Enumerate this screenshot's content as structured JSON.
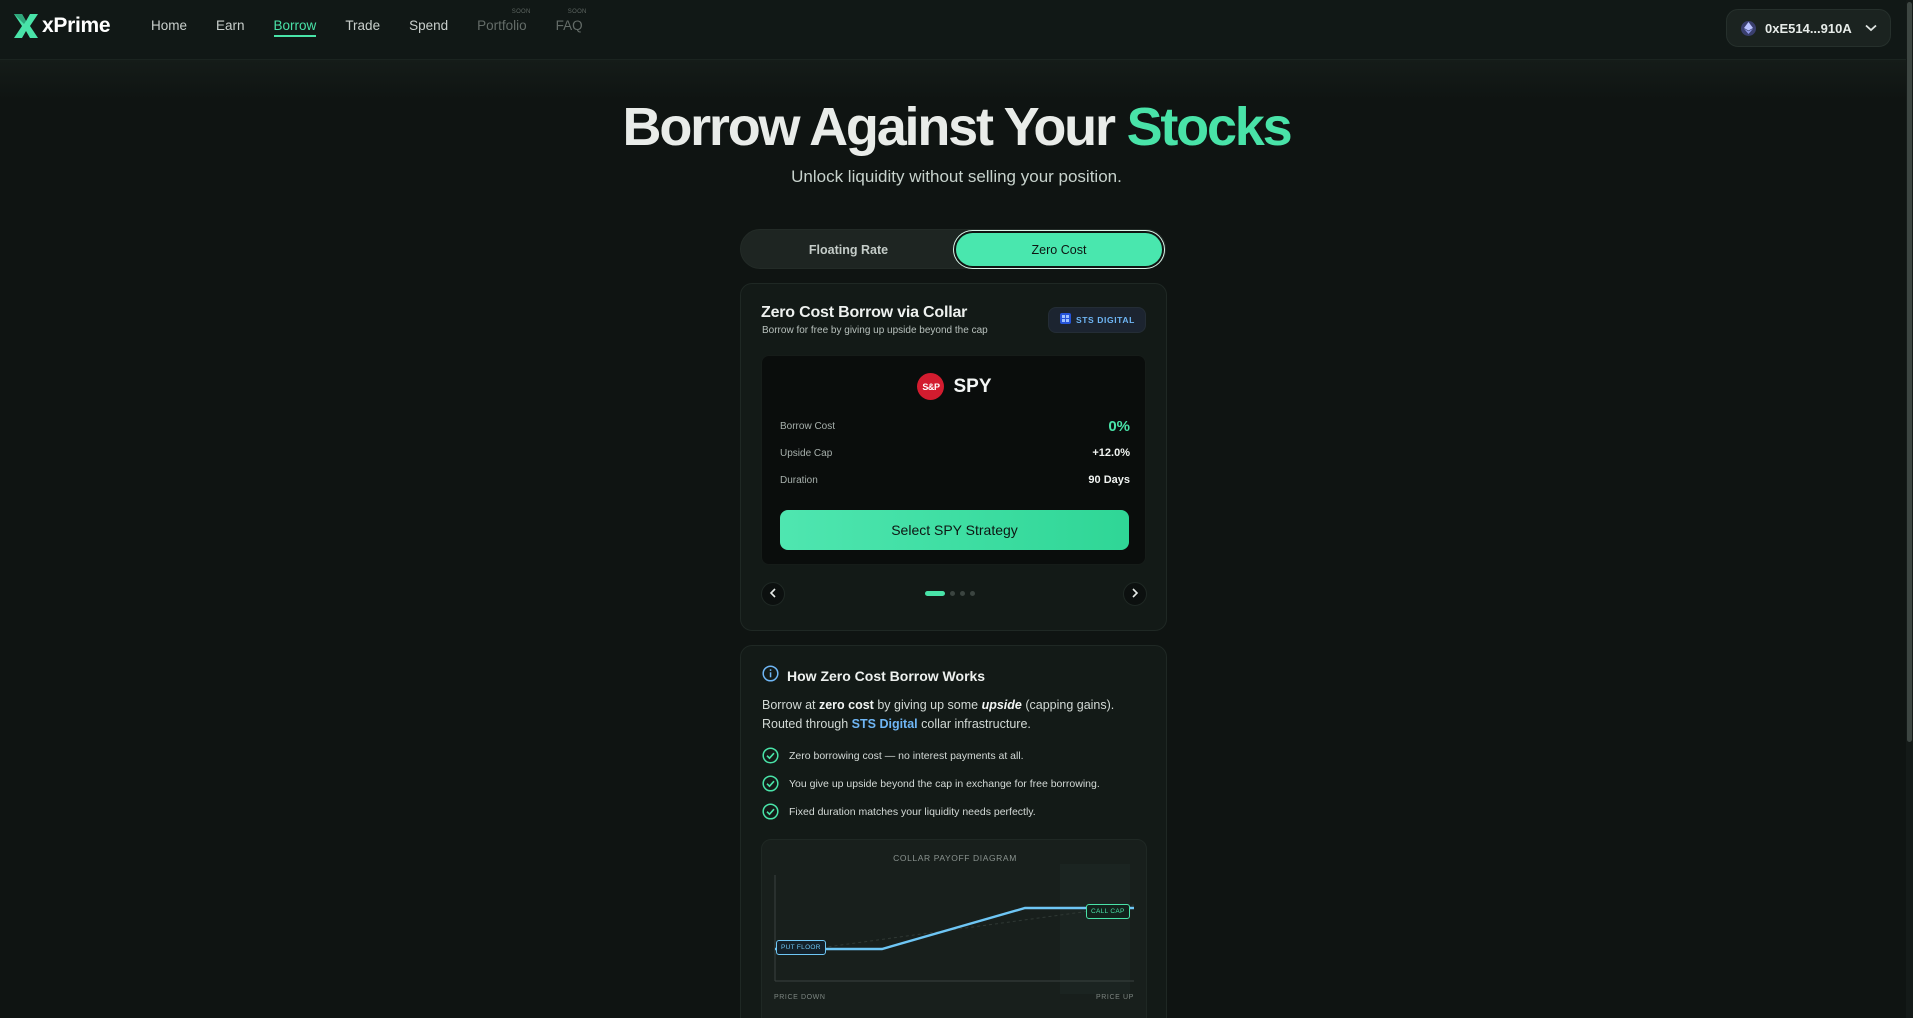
{
  "nav": {
    "brand": "xPrime",
    "links": [
      {
        "label": "Home",
        "state": "normal",
        "soon": ""
      },
      {
        "label": "Earn",
        "state": "normal",
        "soon": ""
      },
      {
        "label": "Borrow",
        "state": "active",
        "soon": ""
      },
      {
        "label": "Trade",
        "state": "normal",
        "soon": ""
      },
      {
        "label": "Spend",
        "state": "normal",
        "soon": ""
      },
      {
        "label": "Portfolio",
        "state": "disabled",
        "soon": "SOON"
      },
      {
        "label": "FAQ",
        "state": "disabled",
        "soon": "SOON"
      }
    ],
    "wallet_address": "0xE514...910A",
    "wallet_icon": "ethereum-icon"
  },
  "hero": {
    "title_main": "Borrow Against Your ",
    "title_accent": "Stocks",
    "subtitle": "Unlock liquidity without selling your position."
  },
  "mode_toggle": {
    "options": [
      "Floating Rate",
      "Zero Cost"
    ],
    "selected": "Zero Cost"
  },
  "strategy_card": {
    "title": "Zero Cost Borrow via Collar",
    "subtitle": "Borrow for free by giving up upside beyond the cap",
    "partner_badge": "STS DIGITAL",
    "asset": {
      "logo_text": "S&P",
      "ticker": "SPY",
      "stats": [
        {
          "label": "Borrow Cost",
          "value": "0%"
        },
        {
          "label": "Upside Cap",
          "value": "+12.0%"
        },
        {
          "label": "Duration",
          "value": "90 Days"
        }
      ],
      "cta": "Select SPY Strategy"
    },
    "carousel": {
      "count": 4,
      "active_index": 0
    }
  },
  "how_it_works": {
    "title": "How Zero Cost Borrow Works",
    "para_1": "Borrow at ",
    "para_bold_1": "zero cost",
    "para_2": " by giving up some ",
    "para_bold_2": "upside",
    "para_3": " (capping gains). Routed through ",
    "para_link": "STS Digital",
    "para_4": " collar infrastructure.",
    "checks": [
      "Zero borrowing cost — no interest payments at all.",
      "You give up upside beyond the cap in exchange for free borrowing.",
      "Fixed duration matches your liquidity needs perfectly."
    ],
    "diagram": {
      "title": "COLLAR PAYOFF DIAGRAM",
      "put_label": "PUT FLOOR",
      "call_label": "CALL CAP",
      "x_left_label": "PRICE DOWN",
      "x_right_label": "PRICE UP"
    }
  },
  "colors": {
    "accent": "#49e3a8",
    "background": "#0f1412",
    "link_blue": "#6fb6f5",
    "sp_red": "#d31c2f"
  }
}
